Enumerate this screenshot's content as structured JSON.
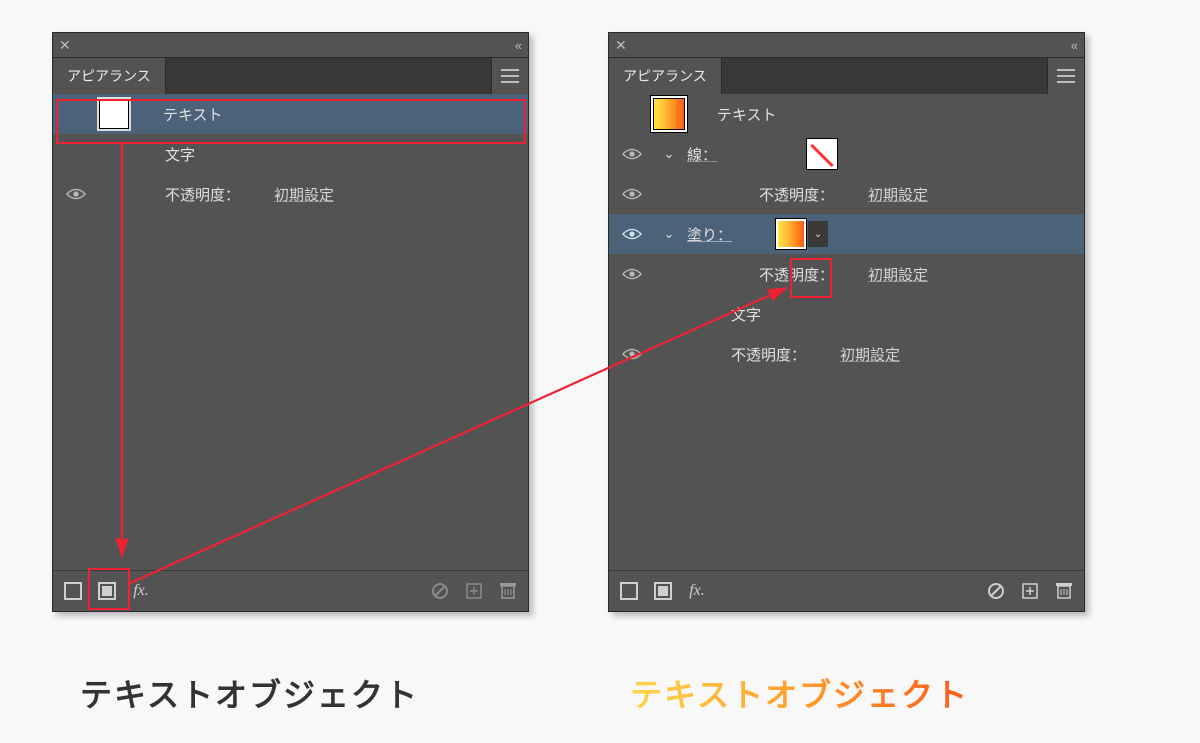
{
  "panelLeft": {
    "tabTitle": "アピアランス",
    "rows": {
      "textLabel": "テキスト",
      "charLabel": "文字",
      "opacityLabel": "不透明度：",
      "opacityValue": "初期設定"
    }
  },
  "panelRight": {
    "tabTitle": "アピアランス",
    "rows": {
      "textLabel": "テキスト",
      "strokeLabel": "線：",
      "opacityLabel": "不透明度：",
      "opacityValue": "初期設定",
      "fillLabel": "塗り：",
      "charLabel": "文字"
    }
  },
  "captions": {
    "left": "テキストオブジェクト",
    "right": "テキストオブジェクト"
  }
}
